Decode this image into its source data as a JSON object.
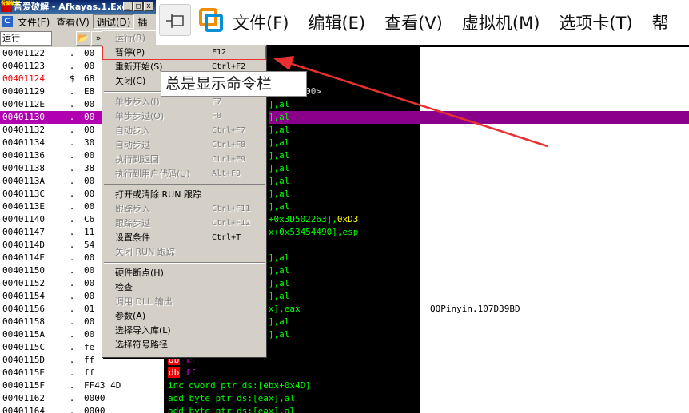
{
  "olly": {
    "title": "吾爱破解 - Afkayas.1.Exe",
    "logo_text": "吾爱破解",
    "window_controls": [
      "_",
      "□",
      "x"
    ],
    "menu": [
      {
        "label": "文件(F)"
      },
      {
        "label": "查看(V)"
      },
      {
        "label": "调试(D)",
        "active": true
      },
      {
        "label": "插"
      }
    ],
    "status": "运行",
    "toolbar_buttons": [
      "📂",
      "»"
    ]
  },
  "code": {
    "rows": [
      {
        "addr": "00401122",
        "flag": ".",
        "hex": "00",
        "dis": [],
        "cmt": ""
      },
      {
        "addr": "00401123",
        "flag": ".",
        "hex": "00",
        "dis": [],
        "cmt": ""
      },
      {
        "addr": "00401124",
        "flag": "$",
        "hex": "68",
        "red": true,
        "dis": [
          {
            "t": "               0",
            "c": "wht"
          }
        ],
        "cmt": ""
      },
      {
        "addr": "00401129",
        "flag": ".",
        "hex": "E8",
        "dis": [
          {
            "t": "               hunRTMain_100>",
            "c": "wht"
          }
        ],
        "cmt": ""
      },
      {
        "addr": "0040112E",
        "flag": ".",
        "hex": "00",
        "dis": [
          {
            "t": "               [eax],al"
          }
        ],
        "cmt": ""
      },
      {
        "addr": "00401130",
        "flag": ".",
        "hex": "00",
        "hl": true,
        "dis": [
          {
            "t": "               [eax],al"
          }
        ],
        "cmt": ""
      },
      {
        "addr": "00401132",
        "flag": ".",
        "hex": "00",
        "dis": [
          {
            "t": "               [eax],al"
          }
        ],
        "cmt": ""
      },
      {
        "addr": "00401134",
        "flag": ".",
        "hex": "30",
        "dis": [
          {
            "t": "               [eax],al"
          }
        ],
        "cmt": ""
      },
      {
        "addr": "00401136",
        "flag": ".",
        "hex": "00",
        "dis": [
          {
            "t": "               [eax],al"
          }
        ],
        "cmt": ""
      },
      {
        "addr": "00401138",
        "flag": ".",
        "hex": "38",
        "dis": [
          {
            "t": "               [eax],al"
          }
        ],
        "cmt": ""
      },
      {
        "addr": "0040113A",
        "flag": ".",
        "hex": "00",
        "dis": [
          {
            "t": "               [eax],al"
          }
        ],
        "cmt": ""
      },
      {
        "addr": "0040113C",
        "flag": ".",
        "hex": "00",
        "dis": [
          {
            "t": "               [eax],al"
          }
        ],
        "cmt": ""
      },
      {
        "addr": "0040113E",
        "flag": ".",
        "hex": "00",
        "dis": [
          {
            "t": "               [eax],al"
          }
        ],
        "cmt": ""
      },
      {
        "addr": "00401140",
        "flag": ".",
        "hex": "C6",
        "dis": [
          {
            "t": "               [eax+0x3D502263],"
          },
          {
            "t": "0xD3",
            "c": "yel"
          }
        ],
        "cmt": ""
      },
      {
        "addr": "00401147",
        "flag": ".",
        "hex": "11",
        "dis": [
          {
            "t": "               :[ebx+0x53454490],esp"
          }
        ],
        "cmt": ""
      },
      {
        "addr": "0040114D",
        "flag": ".",
        "hex": "54",
        "dis": [],
        "cmt": ""
      },
      {
        "addr": "0040114E",
        "flag": ".",
        "hex": "00",
        "dis": [
          {
            "t": "               [eax],al"
          }
        ],
        "cmt": ""
      },
      {
        "addr": "00401150",
        "flag": ".",
        "hex": "00",
        "dis": [
          {
            "t": "               [eax],al"
          }
        ],
        "cmt": ""
      },
      {
        "addr": "00401152",
        "flag": ".",
        "hex": "00",
        "dis": [
          {
            "t": "               [eax],al"
          }
        ],
        "cmt": ""
      },
      {
        "addr": "00401154",
        "flag": ".",
        "hex": "00",
        "dis": [
          {
            "t": "               [eax],al"
          }
        ],
        "cmt": ""
      },
      {
        "addr": "00401156",
        "flag": ".",
        "hex": "01",
        "dis": [
          {
            "t": "               :[eax],eax"
          }
        ],
        "cmt": "QQPinyin.107D39BD"
      },
      {
        "addr": "00401158",
        "flag": ".",
        "hex": "00",
        "dis": [
          {
            "t": "               [eax],al"
          }
        ],
        "cmt": ""
      },
      {
        "addr": "0040115A",
        "flag": ".",
        "hex": "00",
        "dis": [
          {
            "t": "               [eax],al"
          }
        ],
        "cmt": ""
      },
      {
        "addr": "0040115C",
        "flag": ".",
        "hex": "fe",
        "dis": [],
        "cmt": ""
      },
      {
        "addr": "0040115D",
        "flag": ".",
        "hex": "ff",
        "dis": [
          {
            "t": "db",
            "c": "db"
          },
          {
            "t": " ff",
            "c": "mag"
          }
        ],
        "cmt": ""
      },
      {
        "addr": "0040115E",
        "flag": ".",
        "hex": "ff",
        "dis": [
          {
            "t": "db",
            "c": "db"
          },
          {
            "t": " ff",
            "c": "mag"
          }
        ],
        "cmt": ""
      },
      {
        "addr": "0040115F",
        "flag": ".",
        "hex": "FF43 4D",
        "dis": [
          {
            "t": "inc dword ptr ds:[ebx+0x4D]"
          }
        ],
        "cmt": ""
      },
      {
        "addr": "00401162",
        "flag": ".",
        "hex": "0000",
        "dis": [
          {
            "t": "add byte ptr ds:[eax],al"
          }
        ],
        "cmt": ""
      },
      {
        "addr": "00401164",
        "flag": ".",
        "hex": "0000",
        "dis": [
          {
            "t": "add byte ptr ds:[eax],al"
          }
        ],
        "cmt": ""
      }
    ]
  },
  "debug_menu": {
    "items": [
      {
        "label": "运行(R)",
        "shortcut": "F9",
        "disabled": true
      },
      {
        "label": "暂停(P)",
        "shortcut": "F12",
        "boxed": true
      },
      {
        "label": "重新开始(S)",
        "shortcut": "Ctrl+F2"
      },
      {
        "label": "关闭(C)",
        "shortcut": ""
      },
      {
        "sep": true
      },
      {
        "label": "单步步入(I)",
        "shortcut": "F7",
        "disabled": true
      },
      {
        "label": "单步步过(O)",
        "shortcut": "F8",
        "disabled": true
      },
      {
        "label": "自动步入",
        "shortcut": "Ctrl+F7",
        "disabled": true
      },
      {
        "label": "自动步过",
        "shortcut": "Ctrl+F8",
        "disabled": true
      },
      {
        "label": "执行到返回",
        "shortcut": "Ctrl+F9",
        "disabled": true
      },
      {
        "label": "执行到用户代码(U)",
        "shortcut": "Alt+F9",
        "disabled": true
      },
      {
        "sep": true
      },
      {
        "label": "打开或清除 RUN 跟踪",
        "shortcut": ""
      },
      {
        "label": "跟踪步入",
        "shortcut": "Ctrl+F11",
        "disabled": true
      },
      {
        "label": "跟踪步过",
        "shortcut": "Ctrl+F12",
        "disabled": true
      },
      {
        "label": "设置条件",
        "shortcut": "Ctrl+T"
      },
      {
        "label": "关闭 RUN 跟踪",
        "shortcut": "",
        "disabled": true
      },
      {
        "sep": true
      },
      {
        "label": "硬件断点(H)",
        "shortcut": ""
      },
      {
        "label": "检查",
        "shortcut": ""
      },
      {
        "label": "调用 DLL 输出",
        "shortcut": "",
        "disabled": true
      },
      {
        "label": "参数(A)",
        "shortcut": ""
      },
      {
        "label": "选择导入库(L)",
        "shortcut": ""
      },
      {
        "label": "选择符号路径",
        "shortcut": ""
      }
    ]
  },
  "tooltip": "总是显示命令栏",
  "vmware": {
    "pin_icon": "pin-icon",
    "menu": [
      "文件(F)",
      "编辑(E)",
      "查看(V)",
      "虚拟机(M)",
      "选项卡(T)",
      "帮"
    ]
  },
  "colors": {
    "highlight": "#b000b0",
    "asm_text": "#00ff00",
    "annotation_red": "#e83030"
  }
}
